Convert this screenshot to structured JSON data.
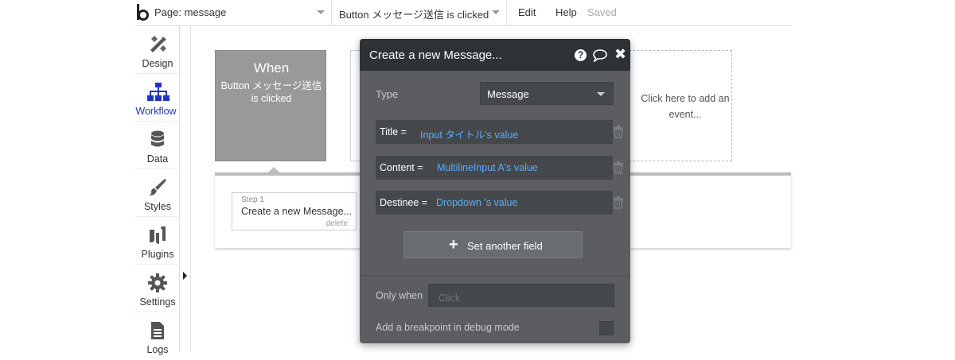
{
  "topbar": {
    "page_selector": "Page: message",
    "event_selector": "Button メッセージ送信 is clicked",
    "menu_edit": "Edit",
    "menu_help": "Help",
    "save_status": "Saved"
  },
  "sidebar": {
    "items": [
      {
        "label": "Design",
        "icon": "design-icon"
      },
      {
        "label": "Workflow",
        "icon": "workflow-icon",
        "active": true
      },
      {
        "label": "Data",
        "icon": "database-icon"
      },
      {
        "label": "Styles",
        "icon": "brush-icon"
      },
      {
        "label": "Plugins",
        "icon": "plug-icon"
      },
      {
        "label": "Settings",
        "icon": "gear-icon"
      },
      {
        "label": "Logs",
        "icon": "document-icon"
      }
    ],
    "active_color": "#2233c4"
  },
  "canvas": {
    "event_card": {
      "title": "When",
      "description": "Button メッセージ送信 is clicked"
    },
    "add_event_text": "Click here to add an event...",
    "step": {
      "number": "Step 1",
      "title": "Create a new Message...",
      "delete": "delete"
    }
  },
  "modal": {
    "title": "Create a new Message...",
    "help_icon": "?",
    "close_icon": "✖",
    "type_label": "Type",
    "type_value": "Message",
    "fields": [
      {
        "key": "Title =",
        "value": "Input タイトル's value"
      },
      {
        "key": "Content =",
        "value": "MultilineInput A's value"
      },
      {
        "key": "Destinee =",
        "value": "Dropdown 's value"
      }
    ],
    "set_another_field": "Set another field",
    "only_when_label": "Only when",
    "only_when_placeholder": "Click",
    "breakpoint_label": "Add a breakpoint in debug mode",
    "value_color": "#56adff",
    "header_color": "#2d3236",
    "body_color": "#5b5d60"
  }
}
